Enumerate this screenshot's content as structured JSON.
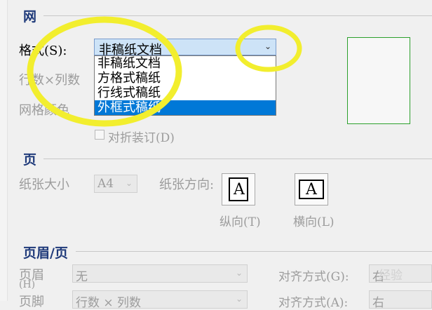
{
  "section_grid": {
    "title": "网",
    "format_label": "格式(S):",
    "format_value": "非稿纸文档",
    "format_options": [
      "非稿纸文档",
      "方格式稿纸",
      "行线式稿纸",
      "外框式稿纸"
    ],
    "highlighted_option": "外框式稿纸",
    "rows_cols_label": "行数×列数",
    "grid_color_label": "网格颜色",
    "fold_binding_label": "对折装订(D)"
  },
  "section_page": {
    "title": "页",
    "paper_size_label": "纸张大小",
    "paper_size_value": "A4",
    "orientation_label": "纸张方向:",
    "portrait_label": "纵向(T)",
    "landscape_label": "横向(L)",
    "page_icon_glyph": "A"
  },
  "section_header_footer": {
    "title": "页眉/页",
    "header_label": "页眉",
    "header_sub": "(H)",
    "header_value": "无",
    "footer_label": "页脚",
    "footer_value": "行数 × 列数",
    "align_label_1": "对齐方式(G):",
    "align_value_1": "右",
    "align_label_2": "对齐方式(A):",
    "align_value_2": "右"
  },
  "watermark": "经验",
  "colors": {
    "highlight": "#0078d7",
    "annotation": "#f2ee2e",
    "preview_border": "#2ca02c"
  }
}
